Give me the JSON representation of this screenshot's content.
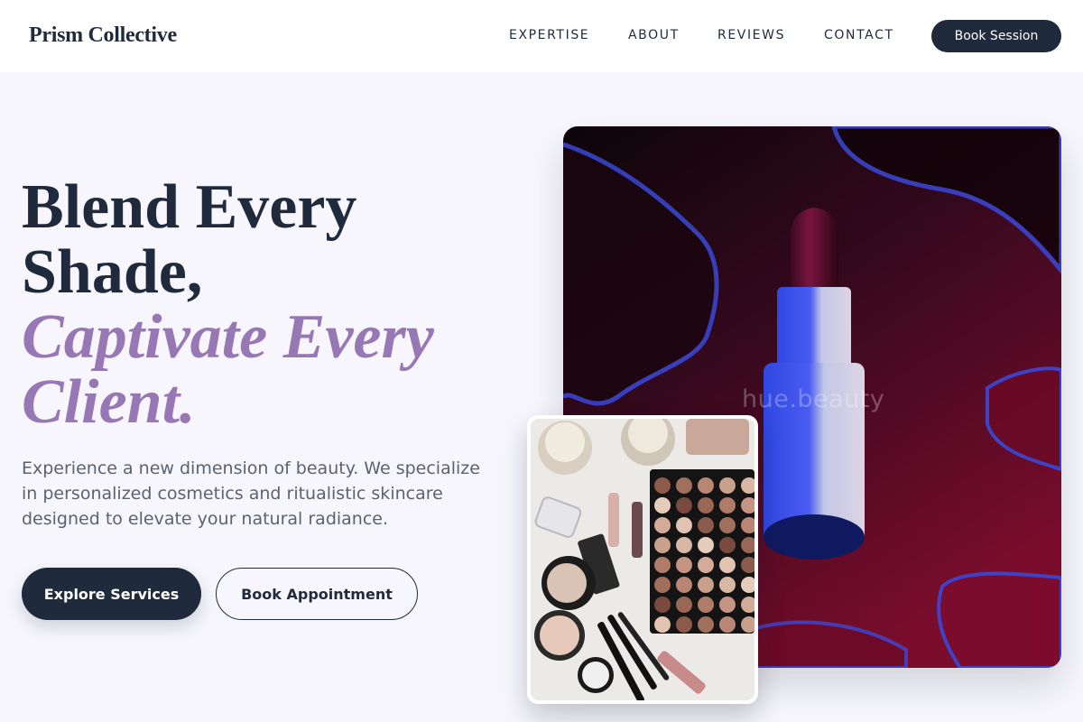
{
  "header": {
    "logo": "Prism Collective",
    "nav": [
      "EXPERTISE",
      "ABOUT",
      "REVIEWS",
      "CONTACT"
    ],
    "cta": "Book Session"
  },
  "hero": {
    "title_line1": "Blend Every",
    "title_line2": "Shade,",
    "title_accent_line1": "Captivate Every",
    "title_accent_line2": "Client.",
    "description": "Experience a new dimension of beauty. We specialize in personalized cosmetics and ritualistic skincare designed to elevate your natural radiance.",
    "primary_button": "Explore Services",
    "secondary_button": "Book Appointment"
  },
  "images": {
    "main_watermark": "hue.beauty"
  },
  "colors": {
    "navy": "#1f2a3c",
    "accent_purple": "#9878b4",
    "background": "#f6f6fc"
  }
}
